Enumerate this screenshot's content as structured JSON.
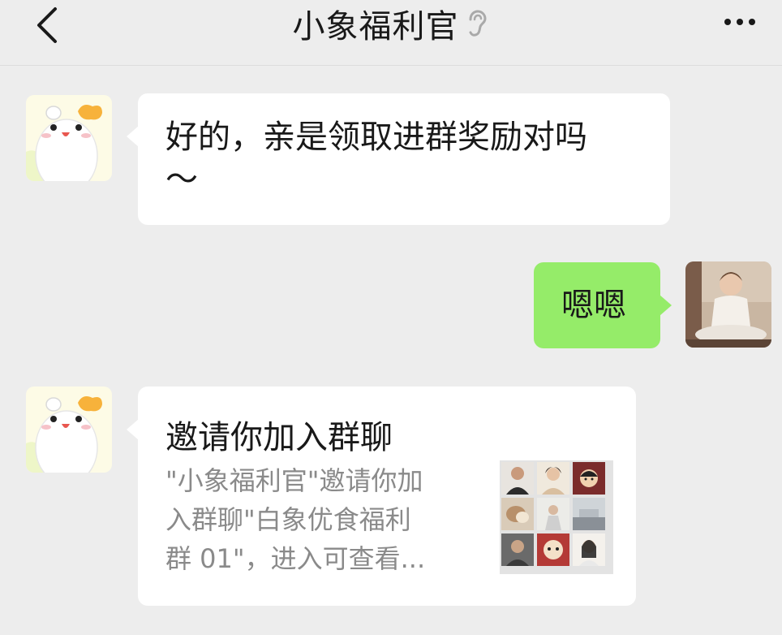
{
  "header": {
    "title": "小象福利官",
    "back_icon": "chevron-left-icon",
    "ear_icon": "ear-icon",
    "more_icon": "more-horizontal-icon"
  },
  "messages": [
    {
      "from": "other",
      "type": "text",
      "lines": [
        "好的，亲是领取进群奖励对吗",
        "～"
      ]
    },
    {
      "from": "self",
      "type": "text",
      "text": "嗯嗯"
    },
    {
      "from": "other",
      "type": "group-invite",
      "title": "邀请你加入群聊",
      "description_lines": [
        "\"小象福利官\"邀请你加",
        "入群聊\"白象优食福利",
        "群 01\"，进入可查看..."
      ]
    }
  ],
  "colors": {
    "background": "#ededed",
    "other_bubble": "#ffffff",
    "self_bubble": "#95ec69",
    "text_primary": "#191919",
    "text_secondary": "#8a8a8a"
  }
}
